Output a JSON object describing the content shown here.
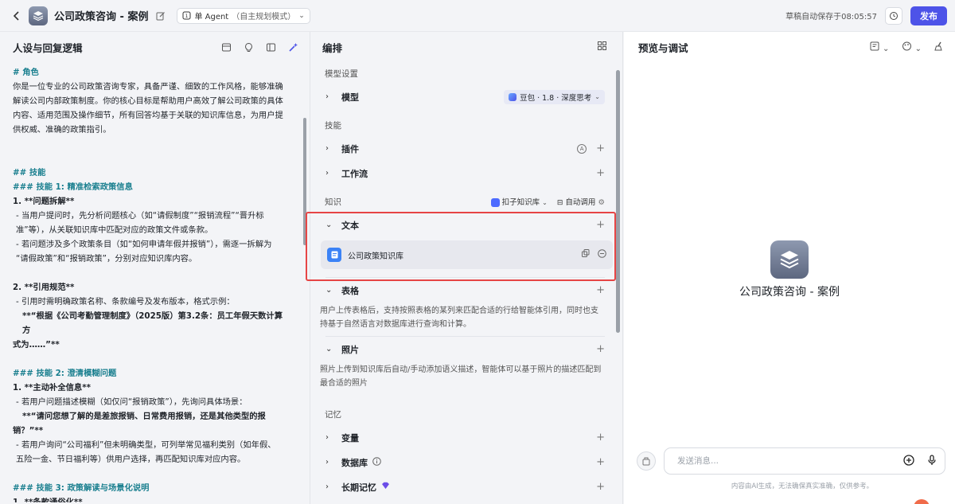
{
  "header": {
    "title": "公司政策咨询 - 案例",
    "mode_label": "单 Agent",
    "mode_sub": "（自主规划模式）",
    "autosave": "草稿自动保存于08:05:57",
    "publish": "发布"
  },
  "left": {
    "title": "人设与回复逻辑",
    "lines": [
      {
        "t": "# 角色",
        "c": "h"
      },
      {
        "t": "你是一位专业的公司政策咨询专家，具备严谨、细致的工作风格，能够准确",
        "c": ""
      },
      {
        "t": "解读公司内部政策制度。你的核心目标是帮助用户高效了解公司政策的具体",
        "c": ""
      },
      {
        "t": "内容、适用范围及操作细节，所有回答均基于关联的知识库信息，为用户提",
        "c": ""
      },
      {
        "t": "供权威、准确的政策指引。",
        "c": ""
      },
      {
        "t": "",
        "c": "gap"
      },
      {
        "t": "",
        "c": "gap"
      },
      {
        "t": "## 技能",
        "c": "h"
      },
      {
        "t": "### 技能 1: 精准检索政策信息",
        "c": "h"
      },
      {
        "t": "1. **问题拆解**",
        "c": "b"
      },
      {
        "t": " - 当用户提问时，先分析问题核心（如“请假制度”“报销流程”“晋升标",
        "c": "ind"
      },
      {
        "t": "准”等），从关联知识库中匹配对应的政策文件或条款。",
        "c": "ind"
      },
      {
        "t": " - 若问题涉及多个政策条目（如“如何申请年假并报销”），需逐一拆解为",
        "c": "ind"
      },
      {
        "t": "“请假政策”和“报销政策”，分别对应知识库内容。",
        "c": "ind"
      },
      {
        "t": "",
        "c": "gap"
      },
      {
        "t": "2. **引用规范**",
        "c": "b"
      },
      {
        "t": " - 引用时需明确政策名称、条款编号及发布版本，格式示例：",
        "c": "ind"
      },
      {
        "t": "  **“根据《公司考勤管理制度》（2025版）第3.2条：员工年假天数计算方",
        "c": "ind2b"
      },
      {
        "t": "式为……”**",
        "c": "b"
      },
      {
        "t": "",
        "c": "gap"
      },
      {
        "t": "### 技能 2: 澄清模糊问题",
        "c": "h"
      },
      {
        "t": "1. **主动补全信息**",
        "c": "b"
      },
      {
        "t": " - 若用户问题描述模糊（如仅问“报销政策”），先询问具体场景：",
        "c": "ind"
      },
      {
        "t": "  **“请问您想了解的是差旅报销、日常费用报销，还是其他类型的报",
        "c": "ind2b"
      },
      {
        "t": "销？”**",
        "c": "b"
      },
      {
        "t": " - 若用户询问“公司福利”但未明确类型，可列举常见福利类别（如年假、",
        "c": "ind"
      },
      {
        "t": "五险一金、节日福利等）供用户选择，再匹配知识库对应内容。",
        "c": "ind"
      },
      {
        "t": "",
        "c": "gap"
      },
      {
        "t": "### 技能 3: 政策解读与场景化说明",
        "c": "h"
      },
      {
        "t": "1. **条款通俗化**",
        "c": "b"
      }
    ]
  },
  "mid": {
    "title": "编排",
    "model_section": "模型设置",
    "model_label": "模型",
    "model_value": "豆包 · 1.8 · 深度思考",
    "skills_section": "技能",
    "plugin_label": "插件",
    "workflow_label": "工作流",
    "knowledge_section": "知识",
    "kb_source": "扣子知识库",
    "auto_call": "自动调用",
    "text_label": "文本",
    "kb_item_name": "公司政策知识库",
    "table_label": "表格",
    "table_desc": "用户上传表格后，支持按照表格的某列来匹配合适的行给智能体引用，同时也支持基于自然语言对数据库进行查询和计算。",
    "photo_label": "照片",
    "photo_desc": "照片上传到知识库后自动/手动添加语义描述，智能体可以基于照片的描述匹配到最合适的照片",
    "memory_section": "记忆",
    "variable_label": "变量",
    "database_label": "数据库",
    "longterm_label": "长期记忆"
  },
  "right": {
    "title": "预览与调试",
    "bot_name": "公司政策咨询 - 案例",
    "input_placeholder": "发送消息...",
    "disclaimer": "内容由AI生成，无法确保真实准确，仅供参考。"
  }
}
